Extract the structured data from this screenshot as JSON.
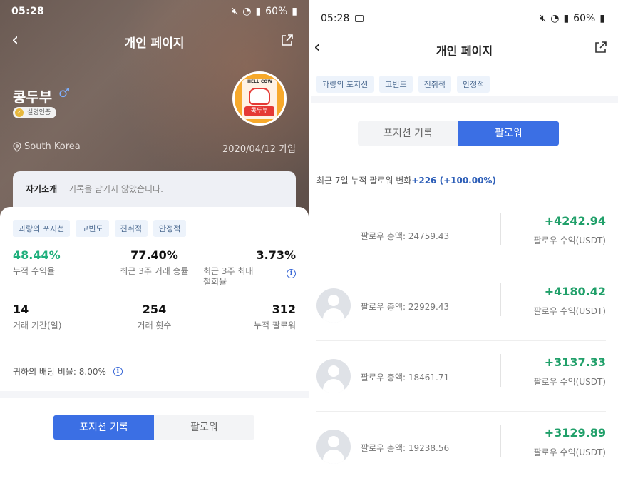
{
  "left": {
    "status": {
      "time": "05:28",
      "battery": "60%"
    },
    "nav": {
      "title": "개인 페이지"
    },
    "profile": {
      "name": "콩두부",
      "gender_symbol": "♂",
      "verified_label": "실명인증",
      "avatar_sign": "HELL COW",
      "avatar_label": "콩두부",
      "location": "South Korea",
      "joined": "2020/04/12 가입"
    },
    "intro": {
      "label": "자기소개",
      "value": "기록을 남기지 않았습니다."
    },
    "tags": [
      "과량의 포지션",
      "고빈도",
      "진취적",
      "안정적"
    ],
    "stats": {
      "cum_return": {
        "value": "48.44%",
        "label": "누적 수익율"
      },
      "win_rate": {
        "value": "77.40%",
        "label": "최근 3주 거래 승률"
      },
      "max_drawdown": {
        "value": "3.73%",
        "label1": "최근 3주 최대",
        "label2": "철회율"
      },
      "period": {
        "value": "14",
        "label": "거래 기간(일)"
      },
      "trades": {
        "value": "254",
        "label": "거래 횟수"
      },
      "followers": {
        "value": "312",
        "label": "누적 팔로워"
      }
    },
    "dividend": "귀하의 배당 비율: 8.00%",
    "toggle": {
      "positions": "포지션 기록",
      "followers": "팔로워"
    }
  },
  "right": {
    "status": {
      "time": "05:28",
      "battery": "60%"
    },
    "nav": {
      "title": "개인 페이지"
    },
    "tags": [
      "과량의 포지션",
      "고빈도",
      "진취적",
      "안정적"
    ],
    "toggle": {
      "positions": "포지션 기록",
      "followers": "팔로워"
    },
    "change": {
      "label": "최근 7일 누적 팔로워 변화",
      "value": "+226 (+100.00%)"
    },
    "followers": [
      {
        "total": "팔로우 총액: 24759.43",
        "profit": "+4242.94",
        "profit_label": "팔로우 수익(USDT)",
        "has_avatar": false
      },
      {
        "total": "팔로우 총액: 22929.43",
        "profit": "+4180.42",
        "profit_label": "팔로우 수익(USDT)",
        "has_avatar": true
      },
      {
        "total": "팔로우 총액: 18461.71",
        "profit": "+3137.33",
        "profit_label": "팔로우 수익(USDT)",
        "has_avatar": true
      },
      {
        "total": "팔로우 총액: 19238.56",
        "profit": "+3129.89",
        "profit_label": "팔로우 수익(USDT)",
        "has_avatar": true
      }
    ]
  },
  "colors": {
    "accent": "#3b6fe4",
    "profit_green": "#21a06a",
    "tag_bg": "#edf3fb",
    "tag_text": "#4d6b91"
  }
}
